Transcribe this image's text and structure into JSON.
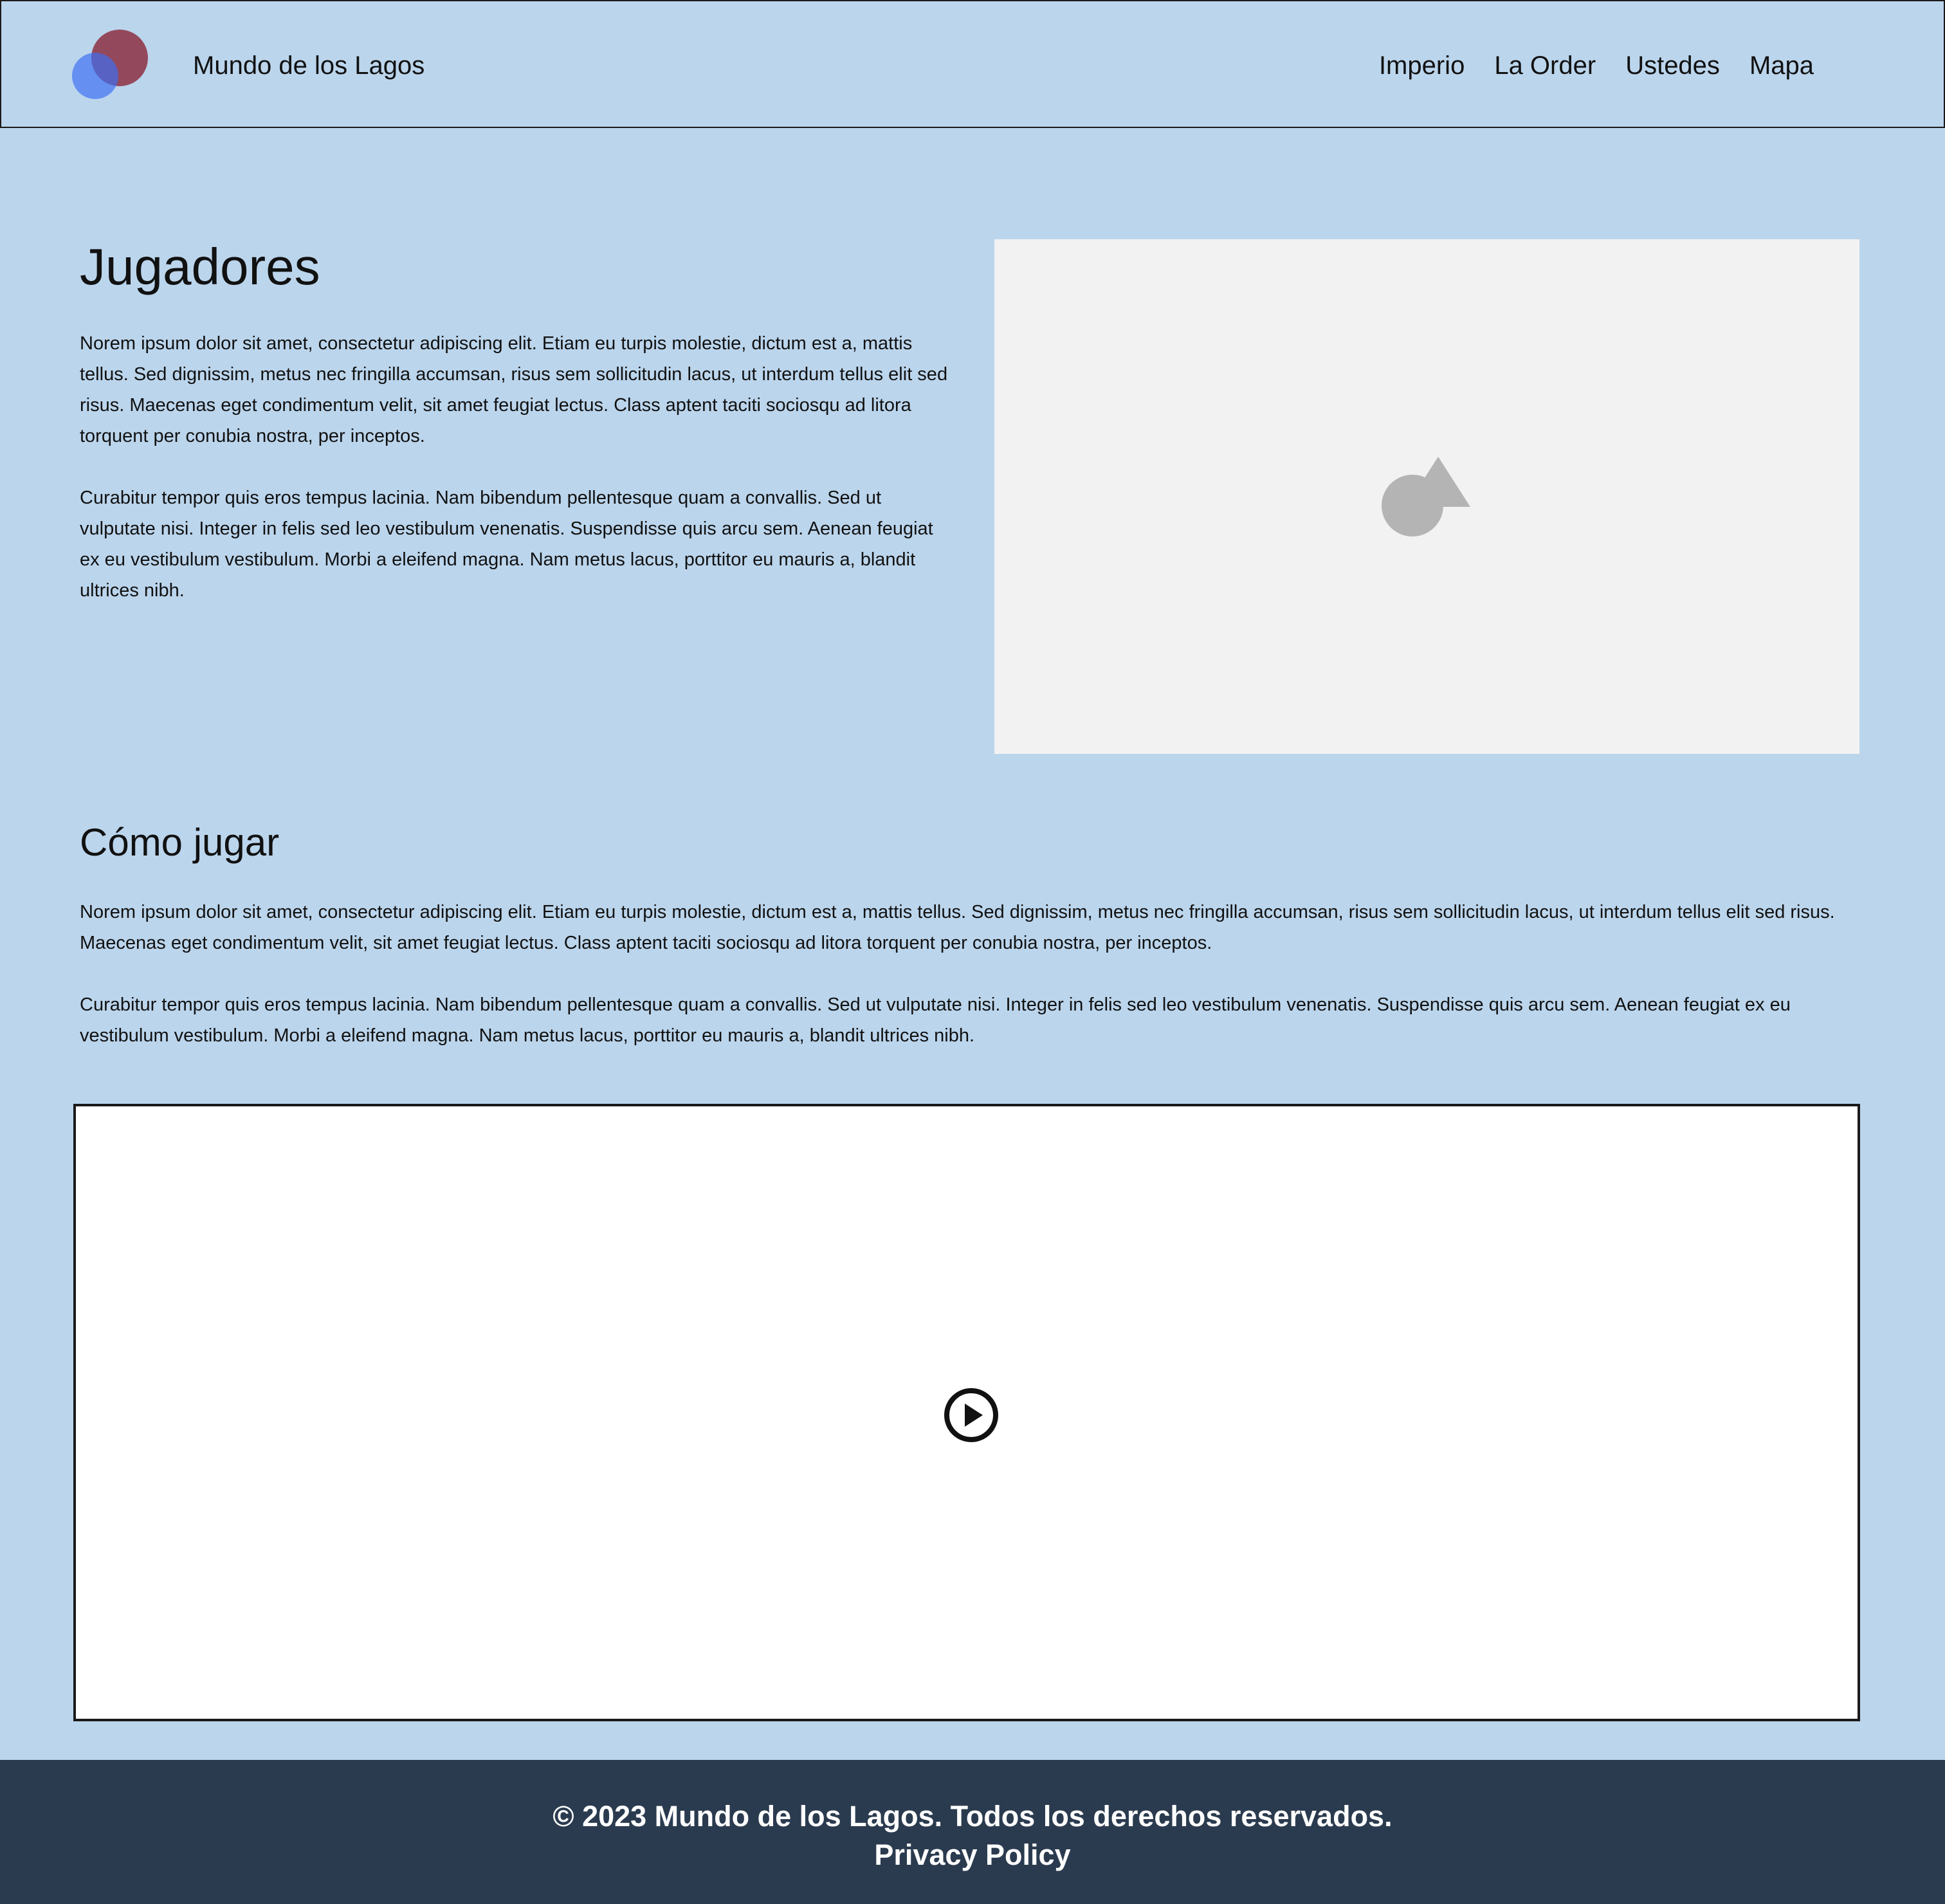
{
  "header": {
    "site_name": "Mundo de los Lagos",
    "nav": [
      "Imperio",
      "La Order",
      "Ustedes",
      "Mapa"
    ]
  },
  "section1": {
    "title": "Jugadores",
    "paragraphs": [
      "Norem ipsum dolor sit amet, consectetur adipiscing elit. Etiam eu turpis molestie, dictum est a, mattis tellus. Sed dignissim, metus nec fringilla accumsan, risus sem sollicitudin lacus, ut interdum tellus elit sed risus. Maecenas eget condimentum velit, sit amet feugiat lectus. Class aptent taciti sociosqu ad litora torquent per conubia nostra, per inceptos.",
      "Curabitur tempor quis eros tempus lacinia. Nam bibendum pellentesque quam a convallis. Sed ut vulputate nisi. Integer in felis sed leo vestibulum venenatis. Suspendisse quis arcu sem. Aenean feugiat ex eu vestibulum vestibulum. Morbi a eleifend magna. Nam metus lacus, porttitor eu mauris a, blandit ultrices nibh."
    ],
    "image_icon": "image-placeholder-icon"
  },
  "section2": {
    "title": "Cómo jugar",
    "paragraphs": [
      "Norem ipsum dolor sit amet, consectetur adipiscing elit. Etiam eu turpis molestie, dictum est a, mattis tellus. Sed dignissim, metus nec fringilla accumsan, risus sem sollicitudin lacus, ut interdum tellus elit sed risus. Maecenas eget condimentum velit, sit amet feugiat lectus. Class aptent taciti sociosqu ad litora torquent per conubia nostra, per inceptos.",
      "Curabitur tempor quis eros tempus lacinia. Nam bibendum pellentesque quam a convallis. Sed ut vulputate nisi. Integer in felis sed leo vestibulum venenatis. Suspendisse quis arcu sem. Aenean feugiat ex eu vestibulum vestibulum. Morbi a eleifend magna. Nam metus lacus, porttitor eu mauris a, blandit ultrices nibh."
    ]
  },
  "video": {
    "icon": "play-circle-icon"
  },
  "footer": {
    "copyright": "© 2023 Mundo de los Lagos. Todos los derechos reservados.",
    "privacy": "Privacy Policy"
  },
  "colors": {
    "background": "#bbd5ec",
    "footer": "#2b3b4f",
    "logo_red": "#8b283c",
    "logo_blue": "#3c6ef5"
  }
}
